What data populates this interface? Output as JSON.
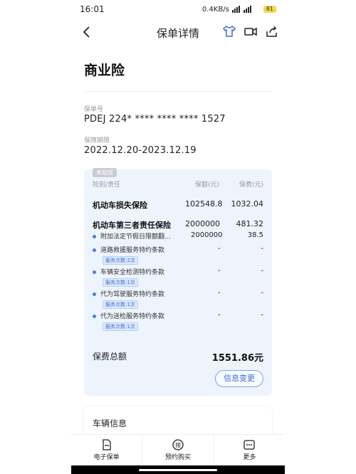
{
  "status": {
    "time": "16:01",
    "network": "0.4KB/s",
    "battery": "81"
  },
  "nav": {
    "title": "保单详情"
  },
  "policy": {
    "section_title": "商业险",
    "number_label": "保单号",
    "number_value": "PDEJ 224* **** **** **** 1527",
    "period_label": "保障期限",
    "period_value": "2022.12.20-2023.12.19"
  },
  "coverage": {
    "tag": "未起保",
    "headers": {
      "item": "险别/责任",
      "amount": "保额(元)",
      "premium": "保费(元)"
    },
    "main_rows": [
      {
        "name": "机动车损失保险",
        "amount": "102548.8",
        "premium": "1032.04"
      },
      {
        "name": "机动车第三者责任保险",
        "amount": "2000000",
        "premium": "481.32"
      }
    ],
    "sub_rows": [
      {
        "name": "附加法定节假日限额翻...",
        "amount": "2000000",
        "premium": "38.5",
        "service": ""
      },
      {
        "name": "道路救援服务特约条款",
        "amount": "-",
        "premium": "-",
        "service": "服务次数:2次"
      },
      {
        "name": "车辆安全检测特约条款",
        "amount": "-",
        "premium": "-",
        "service": "服务次数:1次"
      },
      {
        "name": "代为驾驶服务特约条款",
        "amount": "-",
        "premium": "-",
        "service": "服务次数:1次"
      },
      {
        "name": "代为送检服务特约条款",
        "amount": "-",
        "premium": "-",
        "service": "服务次数:1次"
      }
    ],
    "total_label": "保费总额",
    "total_value": "1551.86元",
    "change_button": "信息变更"
  },
  "vehicle": {
    "title": "车辆信息"
  },
  "tabbar": {
    "items": [
      {
        "label": "电子保单",
        "icon": "document-icon"
      },
      {
        "label": "预约购买",
        "icon": "reserve-icon"
      },
      {
        "label": "更多",
        "icon": "more-icon"
      }
    ]
  },
  "colors": {
    "accent": "#3b6ed1",
    "card_bg": "#eef4fc"
  }
}
